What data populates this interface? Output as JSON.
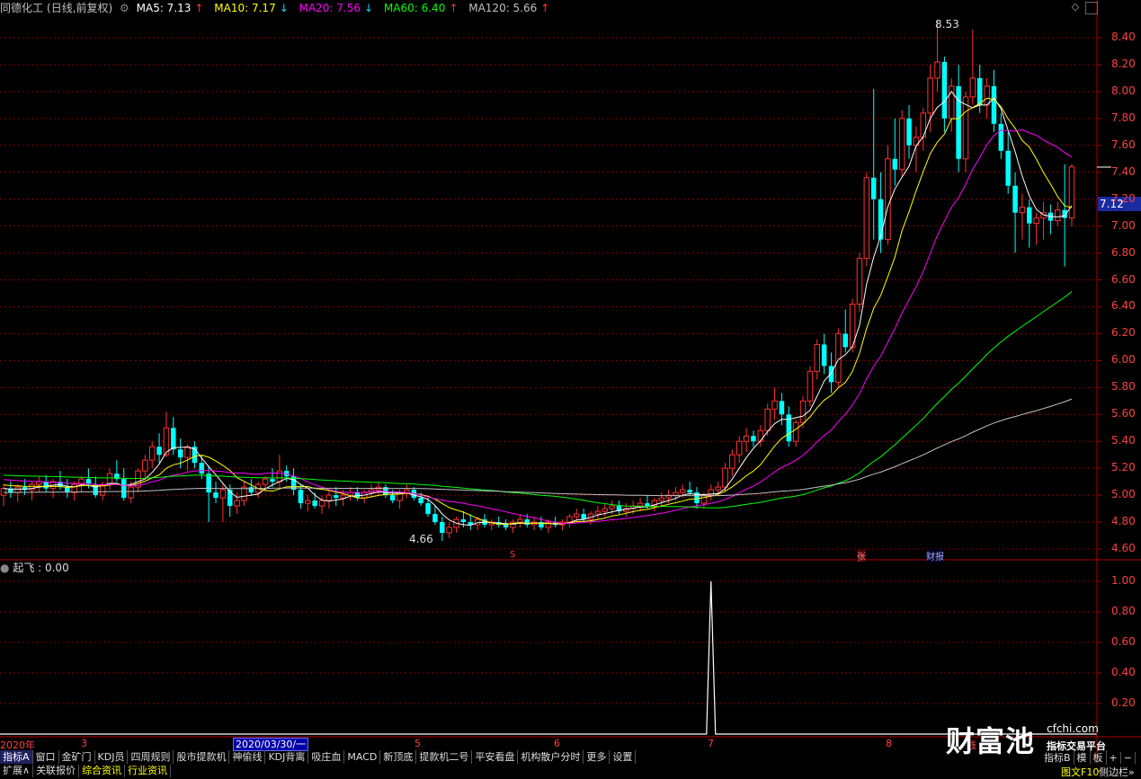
{
  "header": {
    "title": "同德化工",
    "period": "(日线,前复权)",
    "ma5": {
      "label": "MA5: 7.13",
      "arrow": "↑",
      "color": "#ffffff"
    },
    "ma10": {
      "label": "MA10: 7.17",
      "arrow": "↓",
      "color": "#ffff00"
    },
    "ma20": {
      "label": "MA20: 7.56",
      "arrow": "↓",
      "color": "#ff00ff"
    },
    "ma60": {
      "label": "MA60: 6.40",
      "arrow": "↑",
      "color": "#00ff00"
    },
    "ma120": {
      "label": "MA120: 5.66",
      "arrow": "↑",
      "color": "#c0c0c0"
    }
  },
  "sub_header": {
    "label": "起飞 : 0.00"
  },
  "price_tag": "7.12",
  "price_axis": [
    "8.40",
    "8.20",
    "8.00",
    "7.80",
    "7.60",
    "7.40",
    "7.20",
    "7.00",
    "6.80",
    "6.60",
    "6.40",
    "6.20",
    "6.00",
    "5.80",
    "5.60",
    "5.40",
    "5.20",
    "5.00",
    "4.80",
    "4.60"
  ],
  "sub_axis": [
    "1.00",
    "0.80",
    "0.60",
    "0.40",
    "0.20"
  ],
  "annotations": {
    "high": "8.53",
    "low": "4.66",
    "marker_s": "S",
    "marker_zhang": "张",
    "marker_caibao": "财报"
  },
  "dates": {
    "year": "2020年",
    "m3": "3",
    "m5": "5",
    "m6": "6",
    "m7": "7",
    "m8": "8",
    "right": "线",
    "cursor": "2020/03/30/一"
  },
  "tabs": [
    "指标A",
    "窗口",
    "金矿门",
    "KDJ员",
    "四周规则",
    "股市提款机",
    "神偷线",
    "KDJ背离",
    "吸庄血",
    "MACD",
    "新顶底",
    "提款机二号",
    "平安看盘",
    "机构散户分时",
    "更多",
    "设置"
  ],
  "right_tabs": [
    "指标B",
    "模",
    "板",
    "+",
    "−"
  ],
  "bottom": [
    "扩展∧",
    "关联报价",
    "综合资讯",
    "行业资讯"
  ],
  "bottom_right": "图文F10",
  "bottom_right2": "侧边栏»",
  "watermark": {
    "brand": "财富池",
    "site": "cfchi.com",
    "sub": "指标交易平台"
  },
  "colors": {
    "up": "#ff3232",
    "down": "#00ffff",
    "grid": "#8b0000",
    "bg": "#000000"
  },
  "chart_data": {
    "type": "candlestick",
    "ylim": [
      4.5,
      8.5
    ],
    "ohlc": [
      [
        5.0,
        5.08,
        4.92,
        5.05
      ],
      [
        5.05,
        5.1,
        4.98,
        5.02
      ],
      [
        5.02,
        5.08,
        4.95,
        5.06
      ],
      [
        5.06,
        5.12,
        5.0,
        5.04
      ],
      [
        5.04,
        5.1,
        4.96,
        5.08
      ],
      [
        5.08,
        5.14,
        5.02,
        5.1
      ],
      [
        5.1,
        5.15,
        5.02,
        5.05
      ],
      [
        5.05,
        5.12,
        4.98,
        5.1
      ],
      [
        5.1,
        5.18,
        5.04,
        5.06
      ],
      [
        5.06,
        5.12,
        4.98,
        5.02
      ],
      [
        5.02,
        5.1,
        4.96,
        5.08
      ],
      [
        5.08,
        5.14,
        5.02,
        5.12
      ],
      [
        5.12,
        5.2,
        5.05,
        5.08
      ],
      [
        5.08,
        5.14,
        4.98,
        5.0
      ],
      [
        5.0,
        5.1,
        4.96,
        5.08
      ],
      [
        5.08,
        5.2,
        5.04,
        5.16
      ],
      [
        5.16,
        5.26,
        5.1,
        5.12
      ],
      [
        5.12,
        5.2,
        4.96,
        4.98
      ],
      [
        4.98,
        5.1,
        4.94,
        5.06
      ],
      [
        5.06,
        5.2,
        5.02,
        5.18
      ],
      [
        5.18,
        5.3,
        5.12,
        5.26
      ],
      [
        5.26,
        5.4,
        5.2,
        5.36
      ],
      [
        5.36,
        5.46,
        5.24,
        5.3
      ],
      [
        5.3,
        5.62,
        5.28,
        5.5
      ],
      [
        5.5,
        5.58,
        5.3,
        5.34
      ],
      [
        5.34,
        5.42,
        5.2,
        5.28
      ],
      [
        5.28,
        5.38,
        5.18,
        5.36
      ],
      [
        5.36,
        5.4,
        5.2,
        5.24
      ],
      [
        5.24,
        5.3,
        5.12,
        5.16
      ],
      [
        5.16,
        5.22,
        4.8,
        5.02
      ],
      [
        5.02,
        5.1,
        4.94,
        4.98
      ],
      [
        4.98,
        5.08,
        4.8,
        5.04
      ],
      [
        5.04,
        5.08,
        4.84,
        4.92
      ],
      [
        4.92,
        5.02,
        4.86,
        4.96
      ],
      [
        4.96,
        5.1,
        4.92,
        5.06
      ],
      [
        5.06,
        5.12,
        5.0,
        5.02
      ],
      [
        5.02,
        5.1,
        4.98,
        5.08
      ],
      [
        5.08,
        5.14,
        5.02,
        5.12
      ],
      [
        5.12,
        5.2,
        5.06,
        5.1
      ],
      [
        5.1,
        5.3,
        5.06,
        5.18
      ],
      [
        5.18,
        5.22,
        5.1,
        5.14
      ],
      [
        5.14,
        5.2,
        5.0,
        5.04
      ],
      [
        5.04,
        5.08,
        4.9,
        4.94
      ],
      [
        4.94,
        5.0,
        4.88,
        4.96
      ],
      [
        4.96,
        5.02,
        4.9,
        4.92
      ],
      [
        4.92,
        5.0,
        4.86,
        4.96
      ],
      [
        4.96,
        5.04,
        4.9,
        5.0
      ],
      [
        5.0,
        5.06,
        4.92,
        4.98
      ],
      [
        4.98,
        5.04,
        4.92,
        5.0
      ],
      [
        5.0,
        5.06,
        4.96,
        5.02
      ],
      [
        5.02,
        5.06,
        4.96,
        4.98
      ],
      [
        4.98,
        5.04,
        4.94,
        5.02
      ],
      [
        5.02,
        5.08,
        4.98,
        5.04
      ],
      [
        5.04,
        5.1,
        5.0,
        5.06
      ],
      [
        5.06,
        5.08,
        4.98,
        5.0
      ],
      [
        5.0,
        5.04,
        4.94,
        4.96
      ],
      [
        4.96,
        5.04,
        4.9,
        5.02
      ],
      [
        5.02,
        5.08,
        4.98,
        5.04
      ],
      [
        5.04,
        5.06,
        4.96,
        4.98
      ],
      [
        4.98,
        5.02,
        4.92,
        4.94
      ],
      [
        4.94,
        4.98,
        4.84,
        4.86
      ],
      [
        4.86,
        4.92,
        4.78,
        4.8
      ],
      [
        4.8,
        4.84,
        4.66,
        4.72
      ],
      [
        4.72,
        4.8,
        4.68,
        4.76
      ],
      [
        4.76,
        4.84,
        4.72,
        4.82
      ],
      [
        4.82,
        4.88,
        4.76,
        4.8
      ],
      [
        4.8,
        4.86,
        4.74,
        4.78
      ],
      [
        4.78,
        4.84,
        4.74,
        4.82
      ],
      [
        4.82,
        4.86,
        4.76,
        4.78
      ],
      [
        4.78,
        4.82,
        4.74,
        4.8
      ],
      [
        4.8,
        4.84,
        4.76,
        4.78
      ],
      [
        4.78,
        4.82,
        4.74,
        4.76
      ],
      [
        4.76,
        4.82,
        4.72,
        4.8
      ],
      [
        4.8,
        4.86,
        4.76,
        4.82
      ],
      [
        4.82,
        4.86,
        4.76,
        4.78
      ],
      [
        4.78,
        4.84,
        4.74,
        4.8
      ],
      [
        4.8,
        4.84,
        4.74,
        4.76
      ],
      [
        4.76,
        4.82,
        4.72,
        4.8
      ],
      [
        4.8,
        4.84,
        4.76,
        4.78
      ],
      [
        4.78,
        4.82,
        4.74,
        4.8
      ],
      [
        4.8,
        4.86,
        4.76,
        4.84
      ],
      [
        4.84,
        4.9,
        4.8,
        4.86
      ],
      [
        4.86,
        4.9,
        4.8,
        4.82
      ],
      [
        4.82,
        4.88,
        4.78,
        4.86
      ],
      [
        4.86,
        4.92,
        4.82,
        4.88
      ],
      [
        4.88,
        4.94,
        4.84,
        4.9
      ],
      [
        4.9,
        4.96,
        4.86,
        4.92
      ],
      [
        4.92,
        4.96,
        4.86,
        4.88
      ],
      [
        4.88,
        4.94,
        4.84,
        4.9
      ],
      [
        4.9,
        4.96,
        4.86,
        4.92
      ],
      [
        4.92,
        4.98,
        4.88,
        4.94
      ],
      [
        4.94,
        5.0,
        4.9,
        4.92
      ],
      [
        4.92,
        4.98,
        4.88,
        4.96
      ],
      [
        4.96,
        5.02,
        4.92,
        4.98
      ],
      [
        4.98,
        5.04,
        4.94,
        5.0
      ],
      [
        5.0,
        5.06,
        4.96,
        5.02
      ],
      [
        5.02,
        5.08,
        4.98,
        5.04
      ],
      [
        5.04,
        5.1,
        5.0,
        5.02
      ],
      [
        5.02,
        5.06,
        4.9,
        4.94
      ],
      [
        4.94,
        5.02,
        4.9,
        5.0
      ],
      [
        5.0,
        5.08,
        4.96,
        5.04
      ],
      [
        5.04,
        5.1,
        5.0,
        5.06
      ],
      [
        5.06,
        5.24,
        5.02,
        5.2
      ],
      [
        5.2,
        5.34,
        5.14,
        5.3
      ],
      [
        5.3,
        5.44,
        5.24,
        5.4
      ],
      [
        5.4,
        5.5,
        5.32,
        5.44
      ],
      [
        5.44,
        5.48,
        5.36,
        5.4
      ],
      [
        5.4,
        5.52,
        5.36,
        5.48
      ],
      [
        5.48,
        5.68,
        5.44,
        5.64
      ],
      [
        5.64,
        5.8,
        5.56,
        5.7
      ],
      [
        5.7,
        5.76,
        5.52,
        5.6
      ],
      [
        5.6,
        5.66,
        5.36,
        5.4
      ],
      [
        5.4,
        5.56,
        5.36,
        5.54
      ],
      [
        5.54,
        5.74,
        5.5,
        5.7
      ],
      [
        5.7,
        5.96,
        5.66,
        5.92
      ],
      [
        5.92,
        6.16,
        5.86,
        6.12
      ],
      [
        6.12,
        6.2,
        5.9,
        5.96
      ],
      [
        5.96,
        6.06,
        5.76,
        5.84
      ],
      [
        5.84,
        6.24,
        5.8,
        6.2
      ],
      [
        6.2,
        6.38,
        6.06,
        6.1
      ],
      [
        6.1,
        6.46,
        6.06,
        6.42
      ],
      [
        6.42,
        6.8,
        6.36,
        6.76
      ],
      [
        6.76,
        7.4,
        6.7,
        7.36
      ],
      [
        7.36,
        8.02,
        6.9,
        7.2
      ],
      [
        7.2,
        7.4,
        6.8,
        6.9
      ],
      [
        6.9,
        7.6,
        6.86,
        7.5
      ],
      [
        7.5,
        7.8,
        7.3,
        7.42
      ],
      [
        7.42,
        7.86,
        7.36,
        7.8
      ],
      [
        7.8,
        7.9,
        7.5,
        7.6
      ],
      [
        7.6,
        7.74,
        7.4,
        7.66
      ],
      [
        7.66,
        7.88,
        7.56,
        7.84
      ],
      [
        7.84,
        8.2,
        7.7,
        8.1
      ],
      [
        8.1,
        8.53,
        8.0,
        8.22
      ],
      [
        8.22,
        8.26,
        7.7,
        7.8
      ],
      [
        7.8,
        8.1,
        7.7,
        8.04
      ],
      [
        8.04,
        8.2,
        7.4,
        7.5
      ],
      [
        7.5,
        8.0,
        7.4,
        7.96
      ],
      [
        7.96,
        8.46,
        7.9,
        8.1
      ],
      [
        8.1,
        8.2,
        7.84,
        7.9
      ],
      [
        7.9,
        8.1,
        7.8,
        8.04
      ],
      [
        8.04,
        8.16,
        7.7,
        7.76
      ],
      [
        7.76,
        7.84,
        7.5,
        7.56
      ],
      [
        7.56,
        7.7,
        7.24,
        7.3
      ],
      [
        7.3,
        7.4,
        6.8,
        7.1
      ],
      [
        7.1,
        7.24,
        6.9,
        7.14
      ],
      [
        7.14,
        7.2,
        6.84,
        7.02
      ],
      [
        7.02,
        7.1,
        6.86,
        7.06
      ],
      [
        7.06,
        7.18,
        6.9,
        7.1
      ],
      [
        7.1,
        7.16,
        6.94,
        7.04
      ],
      [
        7.04,
        7.18,
        7.0,
        7.12
      ],
      [
        7.12,
        7.46,
        6.7,
        7.06
      ],
      [
        7.06,
        7.46,
        7.0,
        7.44
      ]
    ],
    "signal_spike_index": 100,
    "sub_ylim": [
      0,
      1.05
    ]
  }
}
